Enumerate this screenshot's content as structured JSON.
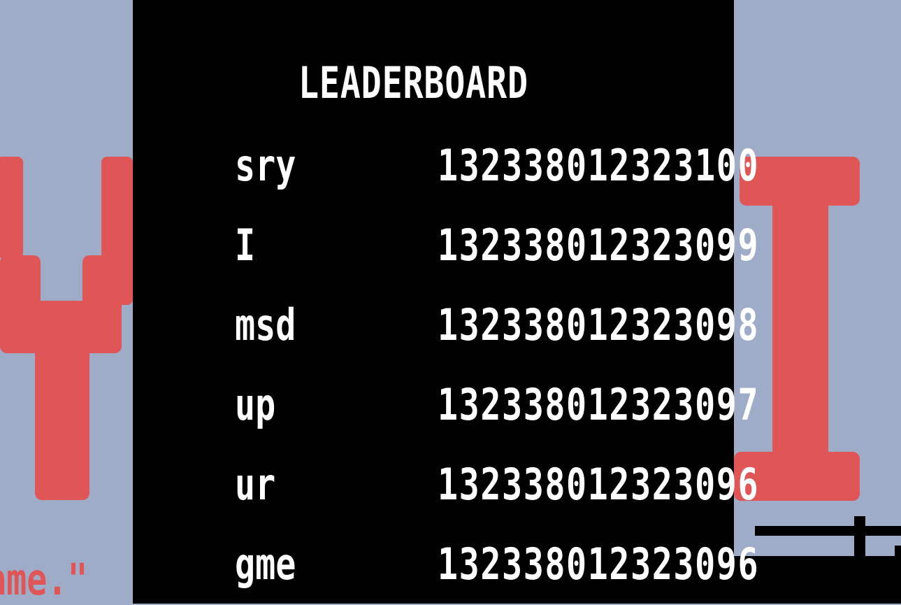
{
  "leaderboard": {
    "title": "LEADERBOARD",
    "entries": [
      {
        "name": "sry",
        "score": "132338012323100"
      },
      {
        "name": "I",
        "score": "132338012323099"
      },
      {
        "name": "msd",
        "score": "132338012323098"
      },
      {
        "name": "up",
        "score": "132338012323097"
      },
      {
        "name": "ur",
        "score": "132338012323096"
      },
      {
        "name": "gme",
        "score": "132338012323096"
      }
    ]
  },
  "background": {
    "left_glyph": "Y",
    "right_glyph": "I",
    "bottom_text": "ame.\""
  },
  "colors": {
    "background": "#9eacc8",
    "panel": "#000000",
    "text": "#ffffff",
    "accent": "#e05555"
  }
}
